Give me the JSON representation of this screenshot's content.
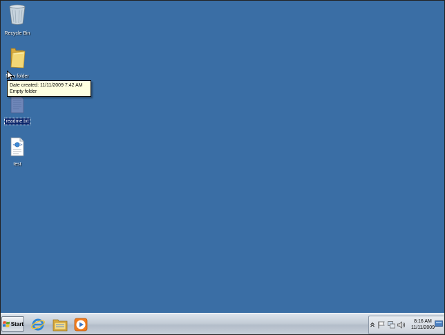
{
  "desktop": {
    "icons": [
      {
        "label": "Recycle Bin",
        "icon": "recycle-bin-icon"
      },
      {
        "label": "New folder",
        "icon": "folder-icon"
      },
      {
        "label": "readme.txt",
        "icon": "text-file-icon",
        "selected": true
      },
      {
        "label": "test",
        "icon": "html-file-icon"
      }
    ],
    "tooltip": {
      "line1": "Date created: 11/11/2009 7:42 AM",
      "line2": "Empty folder"
    }
  },
  "taskbar": {
    "start_label": "Start",
    "quick_launch": [
      "internet-explorer-icon",
      "windows-explorer-icon",
      "media-player-icon"
    ],
    "tray_icons": [
      "show-hidden-icons-chevron",
      "action-center-flag-icon",
      "network-icon",
      "volume-icon"
    ],
    "clock": {
      "time": "8:16 AM",
      "date": "11/11/2009"
    }
  },
  "colors": {
    "desktop_background": "#3a6ea5",
    "taskbar": "#c3ccd6",
    "tooltip_background": "#ffffe1",
    "selection": "#0a246a"
  }
}
